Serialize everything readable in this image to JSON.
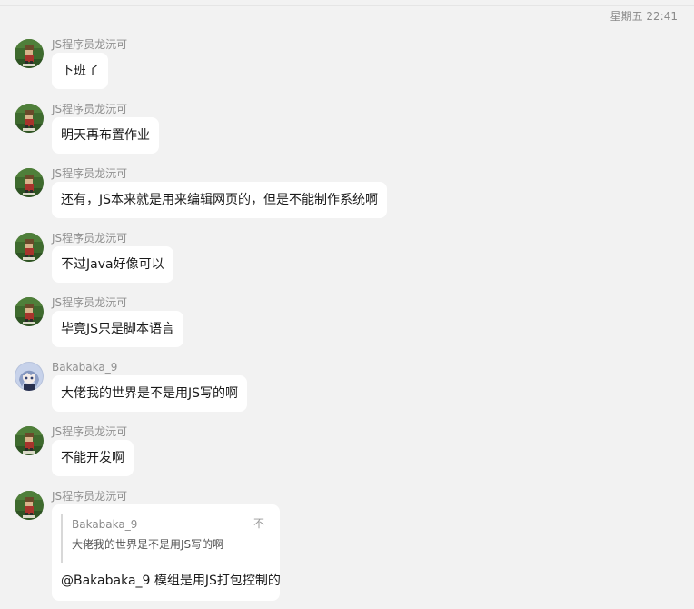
{
  "header": {
    "timestamp": "星期五 22:41"
  },
  "messages": [
    {
      "sender": "JS程序员龙沅可",
      "avatar": "pixel-game-avatar",
      "text": "下班了"
    },
    {
      "sender": "JS程序员龙沅可",
      "avatar": "pixel-game-avatar",
      "text": "明天再布置作业"
    },
    {
      "sender": "JS程序员龙沅可",
      "avatar": "pixel-game-avatar",
      "text": "还有，JS本来就是用来编辑网页的，但是不能制作系统啊"
    },
    {
      "sender": "JS程序员龙沅可",
      "avatar": "pixel-game-avatar",
      "text": "不过Java好像可以"
    },
    {
      "sender": "JS程序员龙沅可",
      "avatar": "pixel-game-avatar",
      "text": "毕竟JS只是脚本语言"
    },
    {
      "sender": "Bakabaka_9",
      "avatar": "anime-avatar",
      "text": "大佬我的世界是不是用JS写的啊"
    },
    {
      "sender": "JS程序员龙沅可",
      "avatar": "pixel-game-avatar",
      "text": "不能开发啊"
    },
    {
      "sender": "JS程序员龙沅可",
      "avatar": "pixel-game-avatar",
      "quote": {
        "name": "Bakabaka_9",
        "icon": "不",
        "text": "大佬我的世界是不是用JS写的啊"
      },
      "text": "@Bakabaka_9 模组是用JS打包控制的"
    }
  ],
  "colors": {
    "background": "#f2f2f2",
    "bubble": "#ffffff",
    "sender": "#8f8f8f",
    "text": "#1a1a1a"
  }
}
